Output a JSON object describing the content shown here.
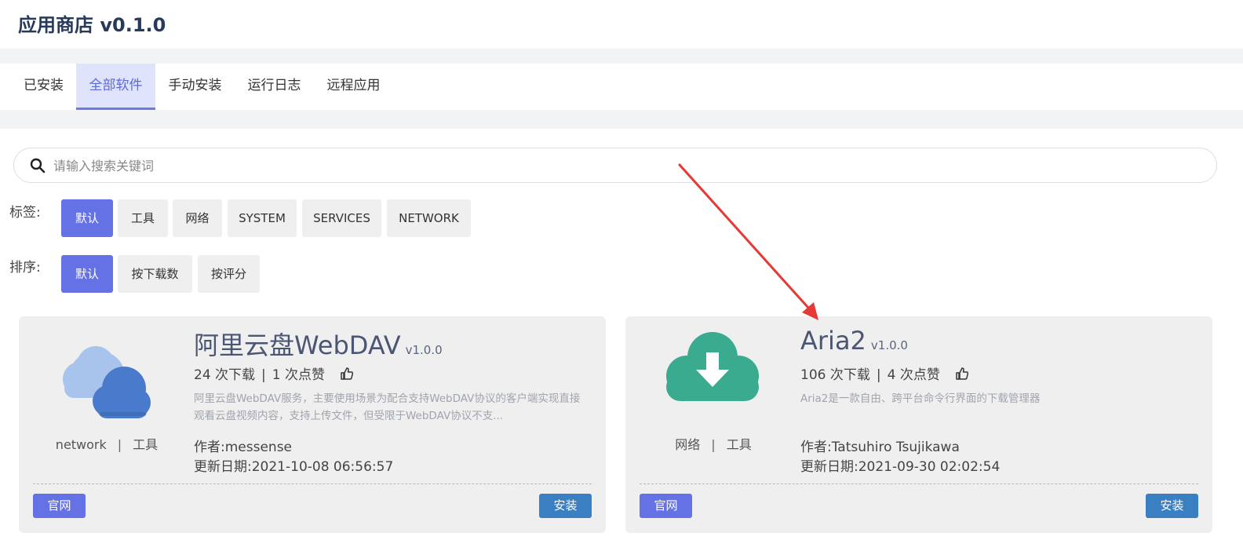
{
  "app": {
    "title": "应用商店 v0.1.0"
  },
  "tabs": [
    {
      "label": "已安装"
    },
    {
      "label": "全部软件",
      "active": true
    },
    {
      "label": "手动安装"
    },
    {
      "label": "运行日志"
    },
    {
      "label": "远程应用"
    }
  ],
  "search": {
    "placeholder": "请输入搜索关键词",
    "value": ""
  },
  "filters": {
    "tags_label": "标签:",
    "tags": [
      "默认",
      "工具",
      "网络",
      "SYSTEM",
      "SERVICES",
      "NETWORK"
    ],
    "tags_selected": "默认",
    "sort_label": "排序:",
    "sort": [
      "默认",
      "按下载数",
      "按评分"
    ],
    "sort_selected": "默认"
  },
  "apps": [
    {
      "name": "阿里云盘WebDAV",
      "version": "v1.0.0",
      "downloads": "24 次下载",
      "likes": "1 次点赞",
      "description": "阿里云盘WebDAV服务，主要使用场景为配合支持WebDAV协议的客户端实现直接观看云盘视频内容，支持上传文件，但受限于WebDAV协议不支...",
      "tags": [
        "network",
        "工具"
      ],
      "author": "作者:messense",
      "updated": "更新日期:2021-10-08 06:56:57",
      "website_label": "官网",
      "install_label": "安装",
      "icon": "cloud-icon"
    },
    {
      "name": "Aria2",
      "version": "v1.0.0",
      "downloads": "106 次下载",
      "likes": "4 次点赞",
      "description": "Aria2是一款自由、跨平台命令行界面的下载管理器",
      "tags": [
        "网络",
        "工具"
      ],
      "author": "作者:Tatsuhiro Tsujikawa",
      "updated": "更新日期:2021-09-30 02:02:54",
      "website_label": "官网",
      "install_label": "安装",
      "icon": "cloud-download-icon"
    }
  ],
  "colors": {
    "primary": "#6472e6",
    "install": "#3a7fc1",
    "tab_active_bg": "#dfe3fb",
    "aria2_icon": "#3aab8f",
    "annotation_arrow": "#e53935"
  }
}
